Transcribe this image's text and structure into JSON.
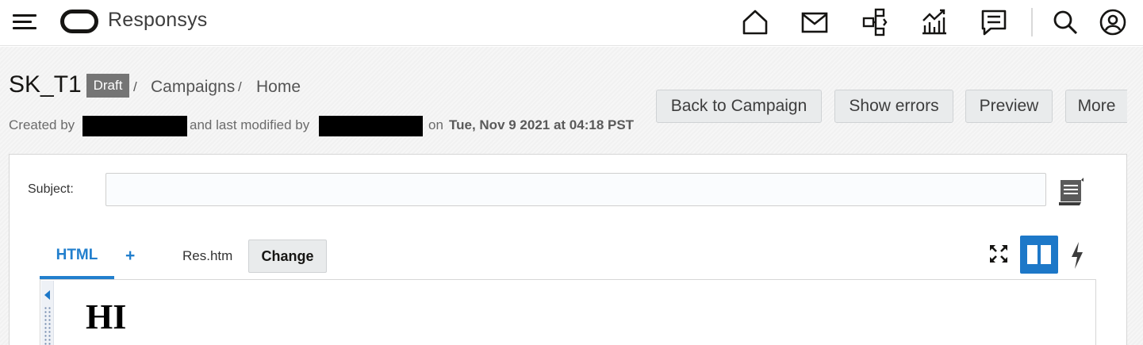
{
  "app": {
    "brand": "Responsys"
  },
  "topnav": {
    "icons": [
      "home-icon",
      "mail-icon",
      "orchestration-icon",
      "analytics-icon",
      "messages-icon",
      "search-icon",
      "user-icon"
    ]
  },
  "page": {
    "title": "SK_T1",
    "status_badge": "Draft",
    "breadcrumb": [
      {
        "label": "Campaigns",
        "sep": "/"
      },
      {
        "label": "Home"
      }
    ],
    "title_sep": "/",
    "meta": {
      "created_by_label": "Created by",
      "modified_by_label": "and last modified by",
      "on_label": "on",
      "date": "Tue, Nov 9 2021 at 04:18 PST"
    }
  },
  "actions": {
    "back": "Back to Campaign",
    "show_errors": "Show errors",
    "preview": "Preview",
    "more": "More"
  },
  "editor": {
    "subject_label": "Subject:",
    "subject_value": "",
    "tab_html": "HTML",
    "tab_add": "+",
    "file_name": "Res.htm",
    "change_label": "Change",
    "preview_text": "HI"
  },
  "colors": {
    "accent": "#227fcd",
    "primary_button": "#1d78c8",
    "badge": "#757575"
  }
}
